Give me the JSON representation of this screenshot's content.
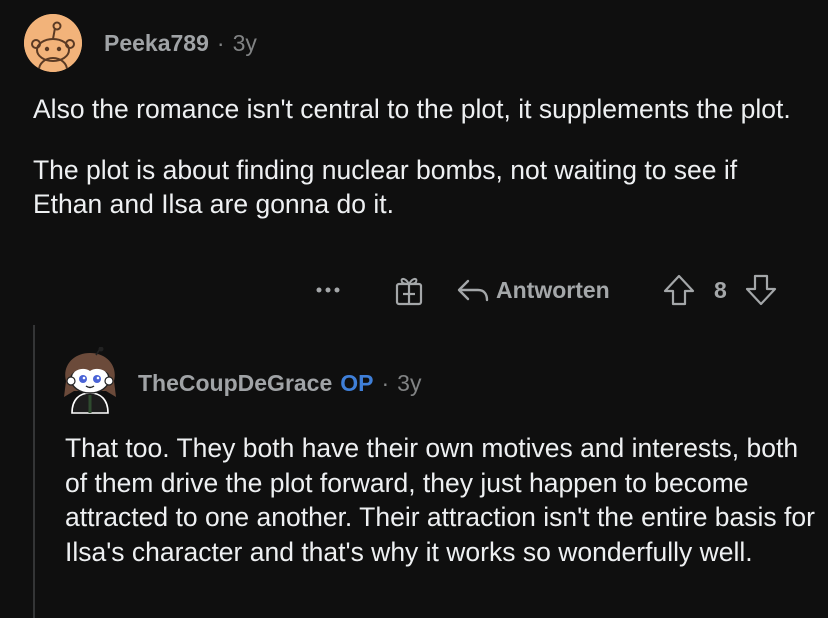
{
  "colors": {
    "background": "#0f0f0f",
    "text": "#eef0f2",
    "meta": "#818384",
    "op_badge": "#3f7fd8",
    "thread_line": "#343536"
  },
  "comment": {
    "author": "Peeka789",
    "separator": "·",
    "age": "3y",
    "avatar_icon": "snoo-avatar-icon",
    "paragraphs": [
      "Also the romance isn't central to the plot, it supplements the plot.",
      "The plot is about finding nuclear bombs, not waiting to see if Ethan and Ilsa are gonna do it."
    ],
    "actions": {
      "more_icon": "more-options-icon",
      "award_icon": "gift-award-icon",
      "reply_icon": "reply-arrow-icon",
      "reply_label": "Antworten",
      "upvote_icon": "upvote-arrow-icon",
      "score": "8",
      "downvote_icon": "downvote-arrow-icon"
    }
  },
  "reply": {
    "author": "TheCoupDeGrace",
    "op_label": "OP",
    "separator": "·",
    "age": "3y",
    "avatar_icon": "custom-snoo-avatar-icon",
    "paragraphs": [
      "That too. They both have their own motives and interests, both of them drive the plot forward, they just happen to become attracted to one another. Their attraction isn't the entire basis for Ilsa's character and that's why it works so wonderfully well."
    ]
  }
}
